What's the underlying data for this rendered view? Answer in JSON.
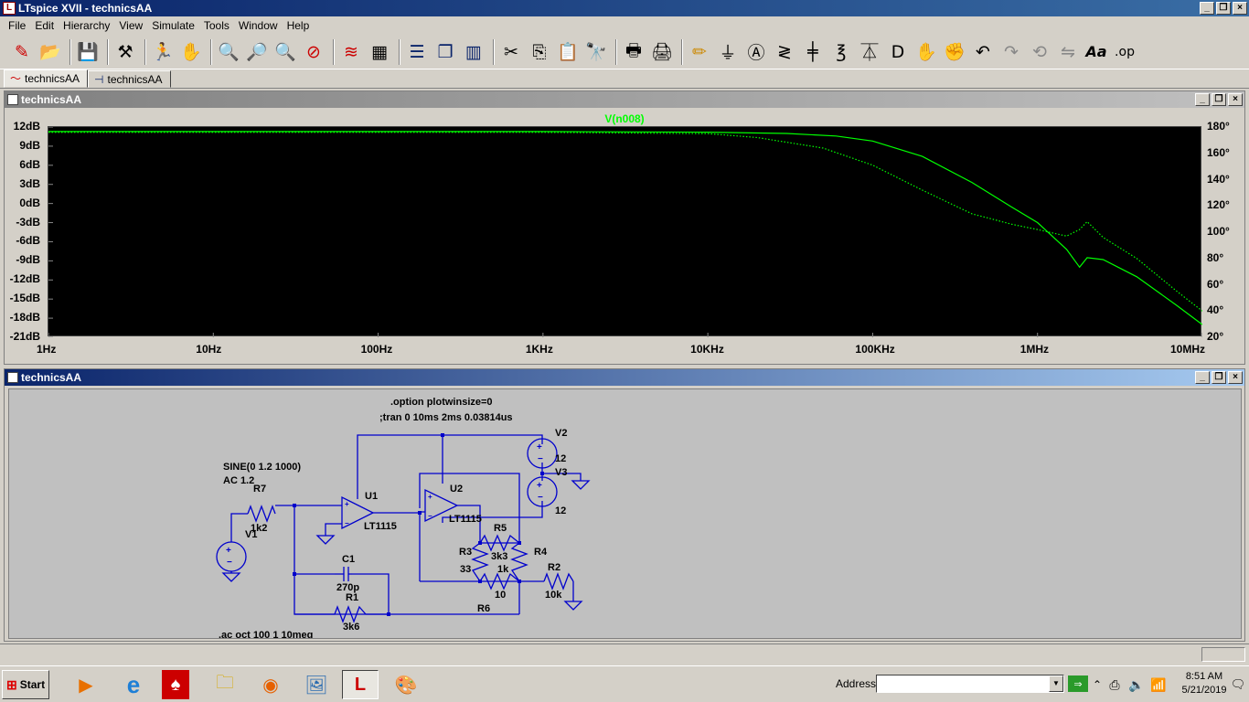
{
  "app": {
    "title": "LTspice XVII - technicsAA",
    "icon": "ltspice-logo-icon"
  },
  "menu": [
    "File",
    "Edit",
    "Hierarchy",
    "View",
    "Simulate",
    "Tools",
    "Window",
    "Help"
  ],
  "toolbar_icons": [
    "new-schematic-icon",
    "open-icon",
    "save-icon",
    "control-panel-icon",
    "run-icon",
    "halt-icon",
    "zoom-in-icon",
    "zoom-area-icon",
    "zoom-out-icon",
    "zoom-cancel-icon",
    "autorange-icon",
    "grid-icon",
    "tile-horizontal-icon",
    "cascade-icon",
    "tile-vertical-icon",
    "cut-icon",
    "copy-icon",
    "paste-icon",
    "find-icon",
    "print-icon",
    "print-setup-icon",
    "wire-icon",
    "ground-icon",
    "label-icon",
    "resistor-icon",
    "capacitor-icon",
    "inductor-icon",
    "diode-icon",
    "component-icon",
    "move-icon",
    "drag-icon",
    "undo-icon",
    "redo-icon",
    "rotate-icon",
    "mirror-icon",
    "text-icon",
    "spice-directive-icon"
  ],
  "tabs": [
    {
      "label": "technicsAA",
      "icon": "waveform-icon",
      "active": true
    },
    {
      "label": "technicsAA",
      "icon": "schematic-icon",
      "active": false
    }
  ],
  "waveform": {
    "window_title": "technicsAA",
    "trace_label": "V(n008)",
    "trace_color": "#00ff00",
    "y_ticks": [
      "12dB",
      "9dB",
      "6dB",
      "3dB",
      "0dB",
      "-3dB",
      "-6dB",
      "-9dB",
      "-12dB",
      "-15dB",
      "-18dB",
      "-21dB"
    ],
    "y2_ticks": [
      "180°",
      "160°",
      "140°",
      "120°",
      "100°",
      "80°",
      "60°",
      "40°",
      "20°"
    ],
    "x_ticks": [
      "1Hz",
      "10Hz",
      "100Hz",
      "1KHz",
      "10KHz",
      "100KHz",
      "1MHz",
      "10MHz"
    ]
  },
  "chart_data": {
    "type": "line",
    "x_scale": "log",
    "xlim": [
      1,
      10000000
    ],
    "ylim": [
      -21,
      12
    ],
    "y2lim": [
      20,
      180
    ],
    "series": [
      {
        "name": "V(n008)",
        "axis": "magnitude",
        "style": "solid",
        "x": [
          1,
          10,
          100,
          1000,
          10000,
          30000,
          60000,
          100000,
          200000,
          400000,
          700000,
          1000000,
          1500000,
          1800000,
          2000000,
          2500000,
          4000000,
          7000000,
          10000000
        ],
        "y": [
          11.3,
          11.3,
          11.3,
          11.3,
          11.2,
          11.0,
          10.6,
          9.8,
          7.4,
          3.3,
          -0.6,
          -3.0,
          -7.2,
          -10.0,
          -8.5,
          -8.8,
          -11.5,
          -16.0,
          -19.0
        ]
      },
      {
        "name": "V(n008)",
        "axis": "phase",
        "style": "dotted",
        "x": [
          1,
          10,
          100,
          1000,
          10000,
          20000,
          50000,
          100000,
          200000,
          400000,
          700000,
          1000000,
          1500000,
          1800000,
          2000000,
          2500000,
          4000000,
          7000000,
          10000000
        ],
        "y": [
          176,
          176,
          176,
          176,
          175,
          172,
          164,
          151,
          132,
          114,
          106,
          102,
          97,
          102,
          108,
          96,
          80,
          55,
          40
        ]
      }
    ]
  },
  "schematic": {
    "window_title": "technicsAA",
    "directive1": ".option plotwinsize=0",
    "directive2": ";tran 0 10ms 2ms 0.03814us",
    "directive3": ".ac oct 100 1 10meg",
    "v1_source": "SINE(0 1.2 1000)",
    "v1_ac": "AC 1.2",
    "labels": {
      "R7": "R7",
      "R7v": "1k2",
      "V1": "V1",
      "U1": "U1",
      "U1m": "LT1115",
      "U2": "U2",
      "U2m": "LT1115",
      "V2": "V2",
      "V2v": "12",
      "V3": "V3",
      "V3v": "12",
      "C1": "C1",
      "C1v": "270p",
      "R1": "R1",
      "R1v": "3k6",
      "R5": "R5",
      "R5v": "3k3",
      "R3": "R3",
      "R3v": "33",
      "R4": "R4",
      "R4v": "1k",
      "R6": "R6",
      "R6v": "10",
      "R2": "R2",
      "R2v": "10k"
    }
  },
  "taskbar": {
    "start": "Start",
    "apps": [
      "media-player-icon",
      "ie-icon",
      "acrobat-icon",
      "explorer-icon",
      "firefox-icon",
      "photo-icon",
      "ltspice-icon",
      "paint-icon"
    ],
    "address_label": "Address",
    "address_value": "",
    "time": "8:51 AM",
    "date": "5/21/2019"
  }
}
